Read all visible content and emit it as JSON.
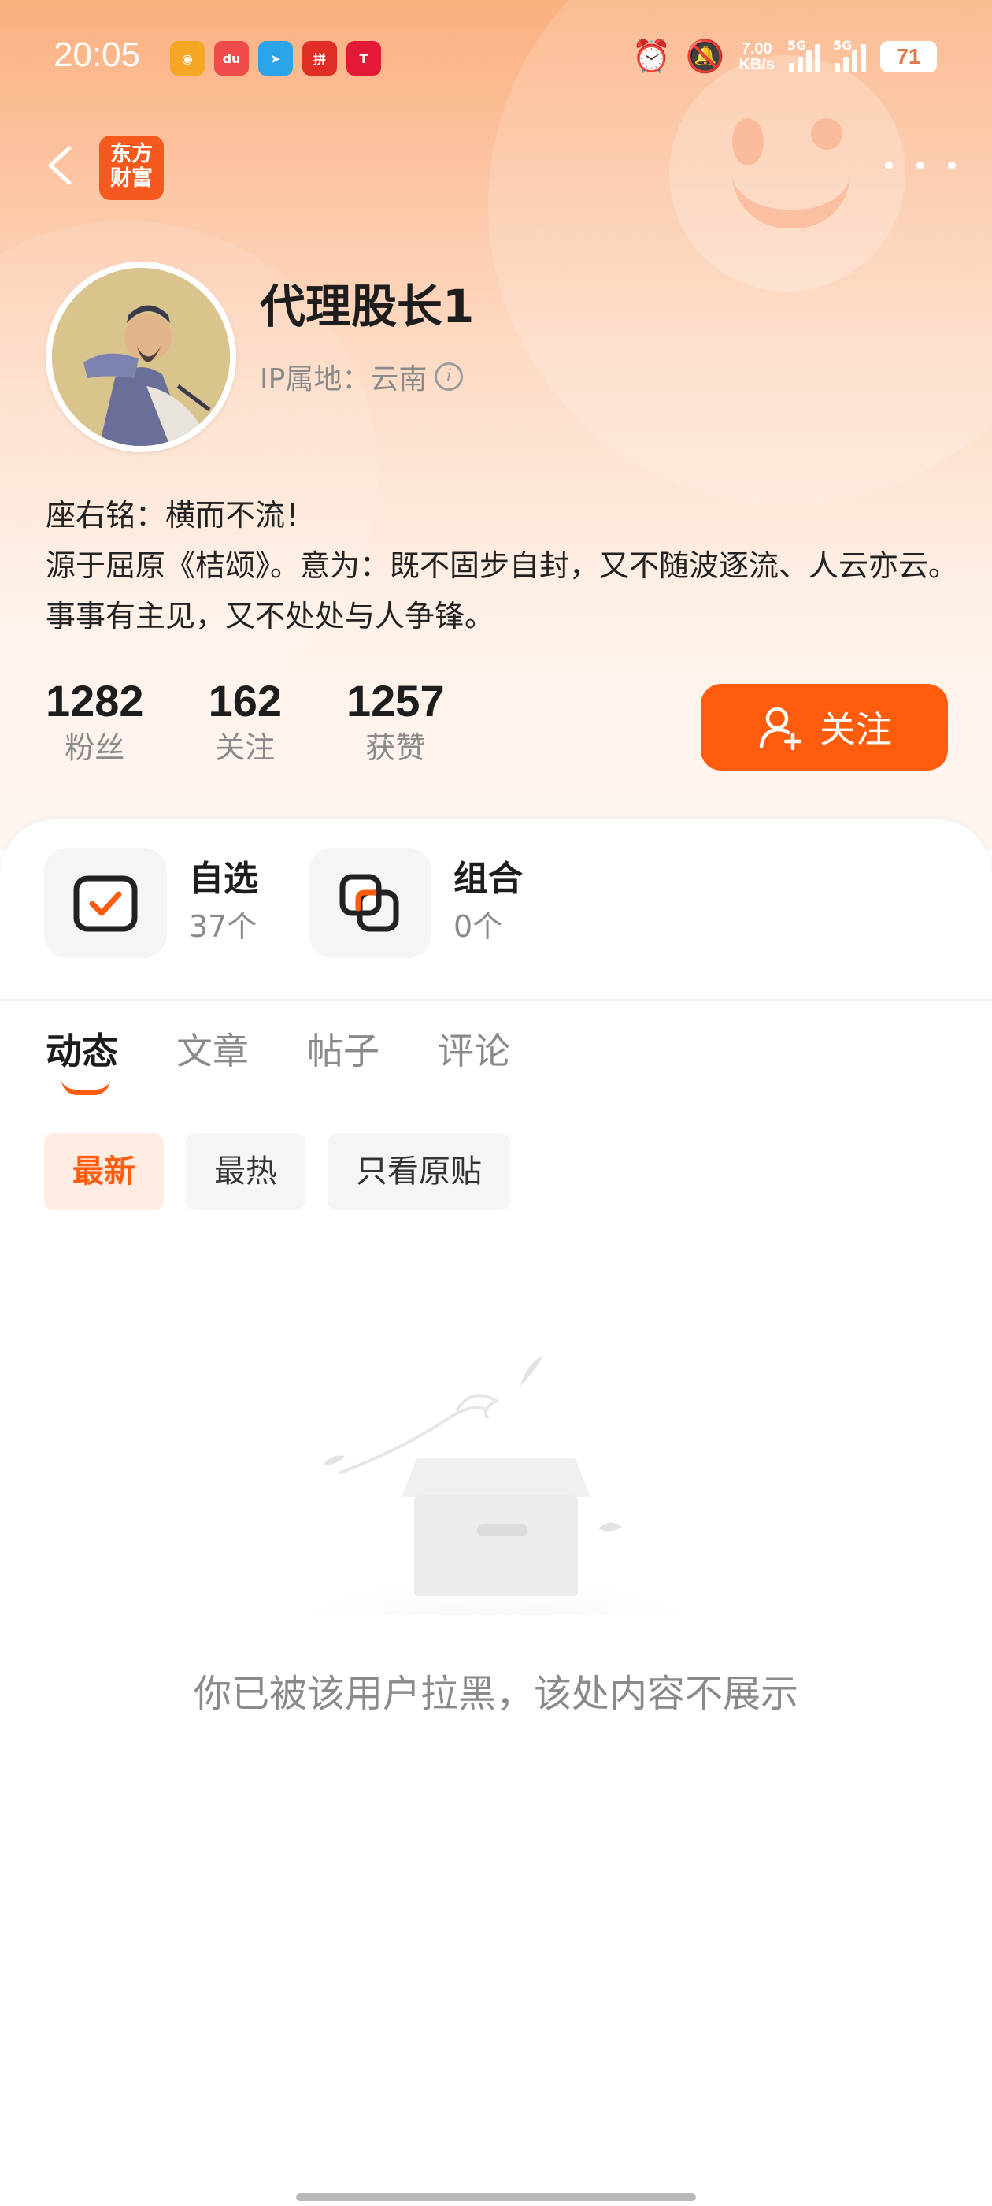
{
  "status_bar": {
    "time": "20:05",
    "apps": [
      {
        "icon": "weibo-app-icon",
        "color": "#f5a623",
        "glyph": "◉"
      },
      {
        "icon": "baidu-map-app-icon",
        "color": "#ef4b4b",
        "glyph": "du"
      },
      {
        "icon": "telegram-app-icon",
        "color": "#2aa3e8",
        "glyph": "➤"
      },
      {
        "icon": "pinduoduo-app-icon",
        "color": "#e02e24",
        "glyph": "拼"
      },
      {
        "icon": "tesla-app-icon",
        "color": "#e31937",
        "glyph": "T"
      }
    ],
    "net_speed_value": "7.00",
    "net_speed_unit": "KB/s",
    "signal1_label": "5G",
    "signal2_label": "5G",
    "battery": "71"
  },
  "header": {
    "logo_line1": "东方",
    "logo_line2": "财富"
  },
  "profile": {
    "name": "代理股长1",
    "ip_location": "IP属地：云南",
    "bio_line1": "座右铭：横而不流！",
    "bio_line2": "源于屈原《桔颂》。意为：既不固步自封，又不随波逐流、人云亦云。事事有主见，又不处处与人争锋。"
  },
  "stats": [
    {
      "value": "1282",
      "label": "粉丝"
    },
    {
      "value": "162",
      "label": "关注"
    },
    {
      "value": "1257",
      "label": "获赞"
    }
  ],
  "follow_button": "关注",
  "quick_entries": [
    {
      "title": "自选",
      "count": "37个"
    },
    {
      "title": "组合",
      "count": "0个"
    }
  ],
  "tabs": [
    "动态",
    "文章",
    "帖子",
    "评论"
  ],
  "filters": [
    "最新",
    "最热",
    "只看原贴"
  ],
  "empty_message": "你已被该用户拉黑，该处内容不展示",
  "colors": {
    "accent": "#ff5c0d",
    "hero_top": "#fbb07f",
    "muted_text": "#8a8a8a"
  }
}
